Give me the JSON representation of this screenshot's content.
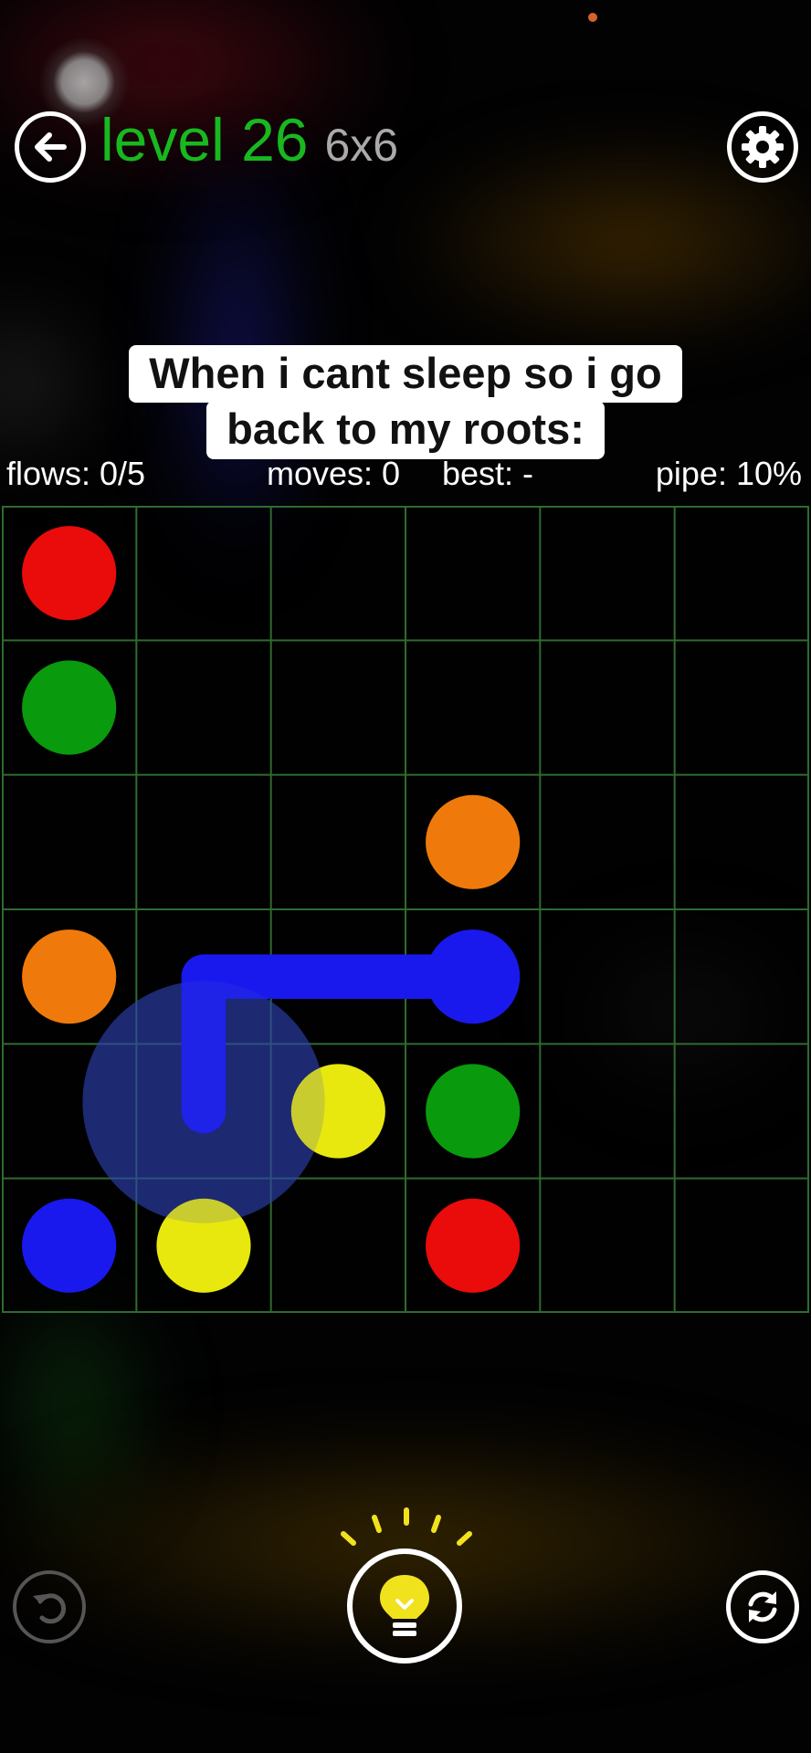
{
  "header": {
    "level_label": "level 26",
    "grid_size": "6x6",
    "back_icon": "arrow-left-icon",
    "settings_icon": "gear-icon"
  },
  "caption": {
    "line1": "When i cant sleep so i go",
    "line2": "back to my roots:"
  },
  "stats": {
    "flows": "flows: 0/5",
    "moves": "moves: 0",
    "best": "best: -",
    "pipe": "pipe: 10%"
  },
  "board": {
    "rows": 6,
    "cols": 6,
    "grid_color": "#2f6b2f",
    "dots": [
      {
        "color": "red",
        "row": 0,
        "col": 0
      },
      {
        "color": "green",
        "row": 1,
        "col": 0
      },
      {
        "color": "orange",
        "row": 2,
        "col": 3
      },
      {
        "color": "orange",
        "row": 3,
        "col": 0
      },
      {
        "color": "blue",
        "row": 3,
        "col": 3
      },
      {
        "color": "yellow",
        "row": 4,
        "col": 2
      },
      {
        "color": "green",
        "row": 4,
        "col": 3
      },
      {
        "color": "blue",
        "row": 5,
        "col": 0
      },
      {
        "color": "yellow",
        "row": 5,
        "col": 1
      },
      {
        "color": "red",
        "row": 5,
        "col": 3
      }
    ],
    "paths": [
      {
        "color": "blue",
        "cells": [
          [
            3,
            3
          ],
          [
            3,
            2
          ],
          [
            3,
            1
          ],
          [
            4,
            1
          ]
        ]
      }
    ],
    "finger_cell": [
      4,
      1
    ],
    "palette": {
      "red": "#ea0b0b",
      "green": "#0a9a0d",
      "orange": "#ef7a0b",
      "blue": "#1919ee",
      "yellow": "#e8e80e"
    }
  },
  "controls": {
    "undo_icon": "undo-icon",
    "hint_icon": "lightbulb-icon",
    "hint_color": "#f0e21c",
    "refresh_icon": "refresh-icon"
  }
}
